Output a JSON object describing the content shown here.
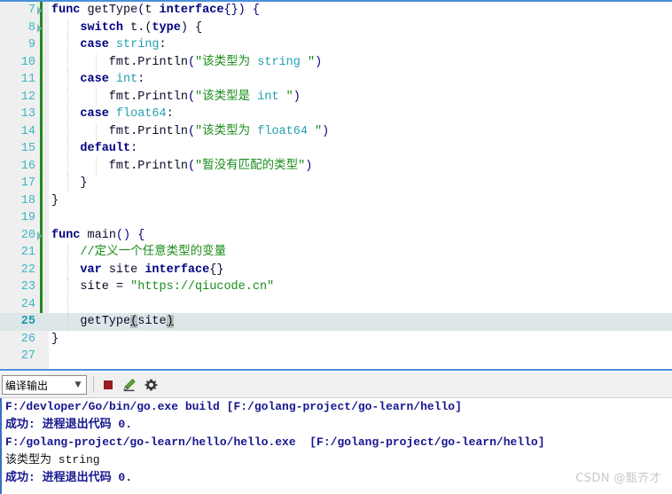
{
  "editor": {
    "language": "go",
    "current_line": 25,
    "lines": [
      {
        "no": "7",
        "fold": true,
        "indent_guides": 0,
        "tokens": [
          {
            "t": "func",
            "c": "kw"
          },
          {
            "t": " ",
            "c": "pln"
          },
          {
            "t": "getType",
            "c": "fn"
          },
          {
            "t": "(",
            "c": "punc"
          },
          {
            "t": "t ",
            "c": "pln"
          },
          {
            "t": "interface",
            "c": "kw"
          },
          {
            "t": "{}) {",
            "c": "punc"
          }
        ]
      },
      {
        "no": "8",
        "fold": true,
        "indent_guides": 1,
        "tokens": [
          {
            "t": "    ",
            "c": "pln"
          },
          {
            "t": "switch",
            "c": "kw"
          },
          {
            "t": " t.(",
            "c": "pln"
          },
          {
            "t": "type",
            "c": "kw"
          },
          {
            "t": ") {",
            "c": "pln"
          }
        ]
      },
      {
        "no": "9",
        "fold": false,
        "indent_guides": 1,
        "tokens": [
          {
            "t": "    ",
            "c": "pln"
          },
          {
            "t": "case",
            "c": "kw"
          },
          {
            "t": " ",
            "c": "pln"
          },
          {
            "t": "string",
            "c": "typ"
          },
          {
            "t": ":",
            "c": "pln"
          }
        ]
      },
      {
        "no": "10",
        "fold": false,
        "indent_guides": 2,
        "tokens": [
          {
            "t": "        fmt.Println",
            "c": "fn"
          },
          {
            "t": "(",
            "c": "punc"
          },
          {
            "t": "\"该类型为 ",
            "c": "str"
          },
          {
            "t": "string",
            "c": "typ"
          },
          {
            "t": " \"",
            "c": "str"
          },
          {
            "t": ")",
            "c": "punc"
          }
        ]
      },
      {
        "no": "11",
        "fold": false,
        "indent_guides": 1,
        "tokens": [
          {
            "t": "    ",
            "c": "pln"
          },
          {
            "t": "case",
            "c": "kw"
          },
          {
            "t": " ",
            "c": "pln"
          },
          {
            "t": "int",
            "c": "typ"
          },
          {
            "t": ":",
            "c": "pln"
          }
        ]
      },
      {
        "no": "12",
        "fold": false,
        "indent_guides": 2,
        "tokens": [
          {
            "t": "        fmt.Println",
            "c": "fn"
          },
          {
            "t": "(",
            "c": "punc"
          },
          {
            "t": "\"该类型是 ",
            "c": "str"
          },
          {
            "t": "int",
            "c": "typ"
          },
          {
            "t": " \"",
            "c": "str"
          },
          {
            "t": ")",
            "c": "punc"
          }
        ]
      },
      {
        "no": "13",
        "fold": false,
        "indent_guides": 1,
        "tokens": [
          {
            "t": "    ",
            "c": "pln"
          },
          {
            "t": "case",
            "c": "kw"
          },
          {
            "t": " ",
            "c": "pln"
          },
          {
            "t": "float64",
            "c": "typ"
          },
          {
            "t": ":",
            "c": "pln"
          }
        ]
      },
      {
        "no": "14",
        "fold": false,
        "indent_guides": 2,
        "tokens": [
          {
            "t": "        fmt.Println",
            "c": "fn"
          },
          {
            "t": "(",
            "c": "punc"
          },
          {
            "t": "\"该类型为 ",
            "c": "str"
          },
          {
            "t": "float64",
            "c": "typ"
          },
          {
            "t": " \"",
            "c": "str"
          },
          {
            "t": ")",
            "c": "punc"
          }
        ]
      },
      {
        "no": "15",
        "fold": false,
        "indent_guides": 1,
        "tokens": [
          {
            "t": "    ",
            "c": "pln"
          },
          {
            "t": "default",
            "c": "kw"
          },
          {
            "t": ":",
            "c": "pln"
          }
        ]
      },
      {
        "no": "16",
        "fold": false,
        "indent_guides": 2,
        "tokens": [
          {
            "t": "        fmt.Println",
            "c": "fn"
          },
          {
            "t": "(",
            "c": "punc"
          },
          {
            "t": "\"暂没有匹配的类型\"",
            "c": "str"
          },
          {
            "t": ")",
            "c": "punc"
          }
        ]
      },
      {
        "no": "17",
        "fold": false,
        "indent_guides": 1,
        "tokens": [
          {
            "t": "    }",
            "c": "pln"
          }
        ]
      },
      {
        "no": "18",
        "fold": false,
        "indent_guides": 0,
        "tokens": [
          {
            "t": "}",
            "c": "pln"
          }
        ]
      },
      {
        "no": "19",
        "fold": false,
        "indent_guides": 0,
        "tokens": []
      },
      {
        "no": "20",
        "fold": true,
        "indent_guides": 0,
        "tokens": [
          {
            "t": "func",
            "c": "kw"
          },
          {
            "t": " ",
            "c": "pln"
          },
          {
            "t": "main",
            "c": "fn"
          },
          {
            "t": "() {",
            "c": "punc"
          }
        ]
      },
      {
        "no": "21",
        "fold": false,
        "indent_guides": 1,
        "tokens": [
          {
            "t": "    ",
            "c": "pln"
          },
          {
            "t": "//定义一个任意类型的变量",
            "c": "cmt"
          }
        ]
      },
      {
        "no": "22",
        "fold": false,
        "indent_guides": 1,
        "tokens": [
          {
            "t": "    ",
            "c": "pln"
          },
          {
            "t": "var",
            "c": "kw"
          },
          {
            "t": " site ",
            "c": "pln"
          },
          {
            "t": "interface",
            "c": "kw"
          },
          {
            "t": "{}",
            "c": "pln"
          }
        ]
      },
      {
        "no": "23",
        "fold": false,
        "indent_guides": 1,
        "tokens": [
          {
            "t": "    site = ",
            "c": "pln"
          },
          {
            "t": "\"https://qiucode.cn\"",
            "c": "str"
          }
        ]
      },
      {
        "no": "24",
        "fold": false,
        "indent_guides": 1,
        "tokens": []
      },
      {
        "no": "25",
        "fold": false,
        "indent_guides": 1,
        "tokens": [
          {
            "t": "    getType",
            "c": "fn"
          },
          {
            "t": "(",
            "c": "brk"
          },
          {
            "t": "site",
            "c": "pln"
          },
          {
            "t": ")",
            "c": "brk"
          }
        ]
      },
      {
        "no": "26",
        "fold": false,
        "indent_guides": 0,
        "tokens": [
          {
            "t": "}",
            "c": "pln"
          }
        ]
      },
      {
        "no": "27",
        "fold": false,
        "indent_guides": 0,
        "tokens": []
      }
    ]
  },
  "output_panel": {
    "selector": {
      "selected": "编译输出",
      "arrow": "chevron-down-icon",
      "options": [
        "编译输出"
      ]
    },
    "buttons": [
      {
        "name": "stop-button",
        "icon": "stop-square-icon"
      },
      {
        "name": "clear-button",
        "icon": "eraser-icon"
      },
      {
        "name": "settings-button",
        "icon": "gear-icon"
      }
    ],
    "lines": [
      {
        "text": "F:/devloper/Go/bin/go.exe build [F:/golang-project/go-learn/hello]",
        "style": "navy"
      },
      {
        "text": "成功: 进程退出代码 0.",
        "style": "navy"
      },
      {
        "text": "F:/golang-project/go-learn/hello/hello.exe  [F:/golang-project/go-learn/hello]",
        "style": "navy"
      },
      {
        "text": "该类型为 string",
        "style": "plain"
      },
      {
        "text": "成功: 进程退出代码 0.",
        "style": "navy"
      }
    ]
  },
  "watermark": {
    "text": "CSDN @甄齐才"
  },
  "colors": {
    "keyword": "#000080",
    "type": "#22a0ad",
    "string": "#1a8c1a",
    "comment": "#1a8c1a",
    "line_number": "#3cb5c4",
    "change_bar": "#1f8b1f",
    "current_line_bg": "#dde6e8",
    "editor_border": "#4a90d9",
    "output_text_navy": "#16168f",
    "toolbar_bg": "#f0f0f0",
    "gutter_bg": "#efefef",
    "stop_icon": "#9b1b23"
  }
}
